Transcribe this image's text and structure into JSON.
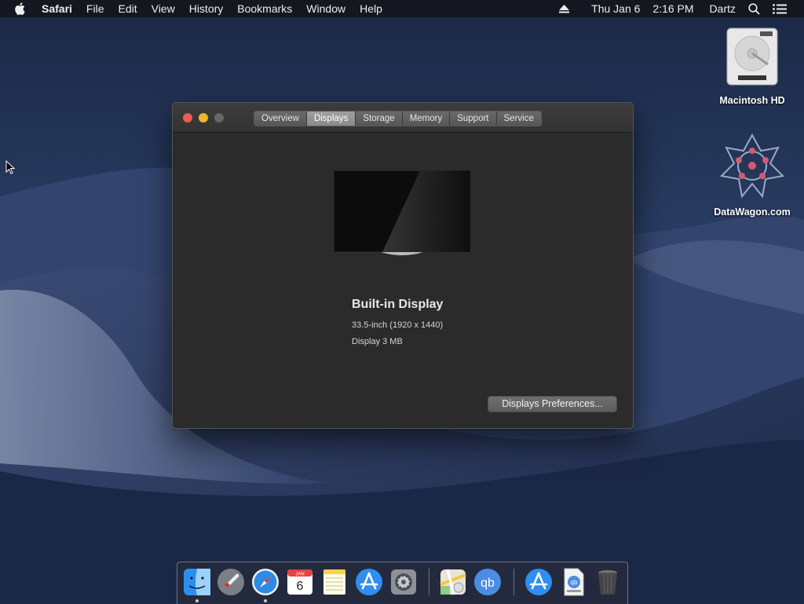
{
  "menubar": {
    "app_name": "Safari",
    "items": [
      "File",
      "Edit",
      "View",
      "History",
      "Bookmarks",
      "Window",
      "Help"
    ],
    "date": "Thu Jan 6",
    "time": "2:16 PM",
    "user": "Dartz"
  },
  "window": {
    "tabs": [
      "Overview",
      "Displays",
      "Storage",
      "Memory",
      "Support",
      "Service"
    ],
    "active_tab": "Displays",
    "display": {
      "name": "Built-in Display",
      "resolution": "33.5-inch (1920 x 1440)",
      "memory": "Display 3 MB"
    },
    "prefs_button": "Displays Preferences..."
  },
  "desktop": {
    "icons": [
      {
        "label": "Macintosh HD",
        "icon": "hard-drive-icon"
      },
      {
        "label": "DataWagon.com",
        "icon": "datawagon-logo-icon"
      }
    ]
  },
  "dock": {
    "items": [
      {
        "name": "finder",
        "running": true
      },
      {
        "name": "launchpad",
        "running": false
      },
      {
        "name": "safari",
        "running": true
      },
      {
        "name": "calendar",
        "running": false,
        "month": "JAN",
        "day": "6"
      },
      {
        "name": "notes",
        "running": false
      },
      {
        "name": "app-store",
        "running": false
      },
      {
        "name": "system-preferences",
        "running": false
      },
      {
        "name": "maps",
        "running": false
      },
      {
        "name": "qbittorrent",
        "running": false
      },
      {
        "name": "app-store-downloads",
        "running": false
      },
      {
        "name": "torrent-file",
        "running": false
      },
      {
        "name": "trash",
        "running": false
      }
    ]
  },
  "colors": {
    "close": "#ee5a52",
    "minimize": "#f1b42f",
    "zoom_disabled": "#666666"
  }
}
